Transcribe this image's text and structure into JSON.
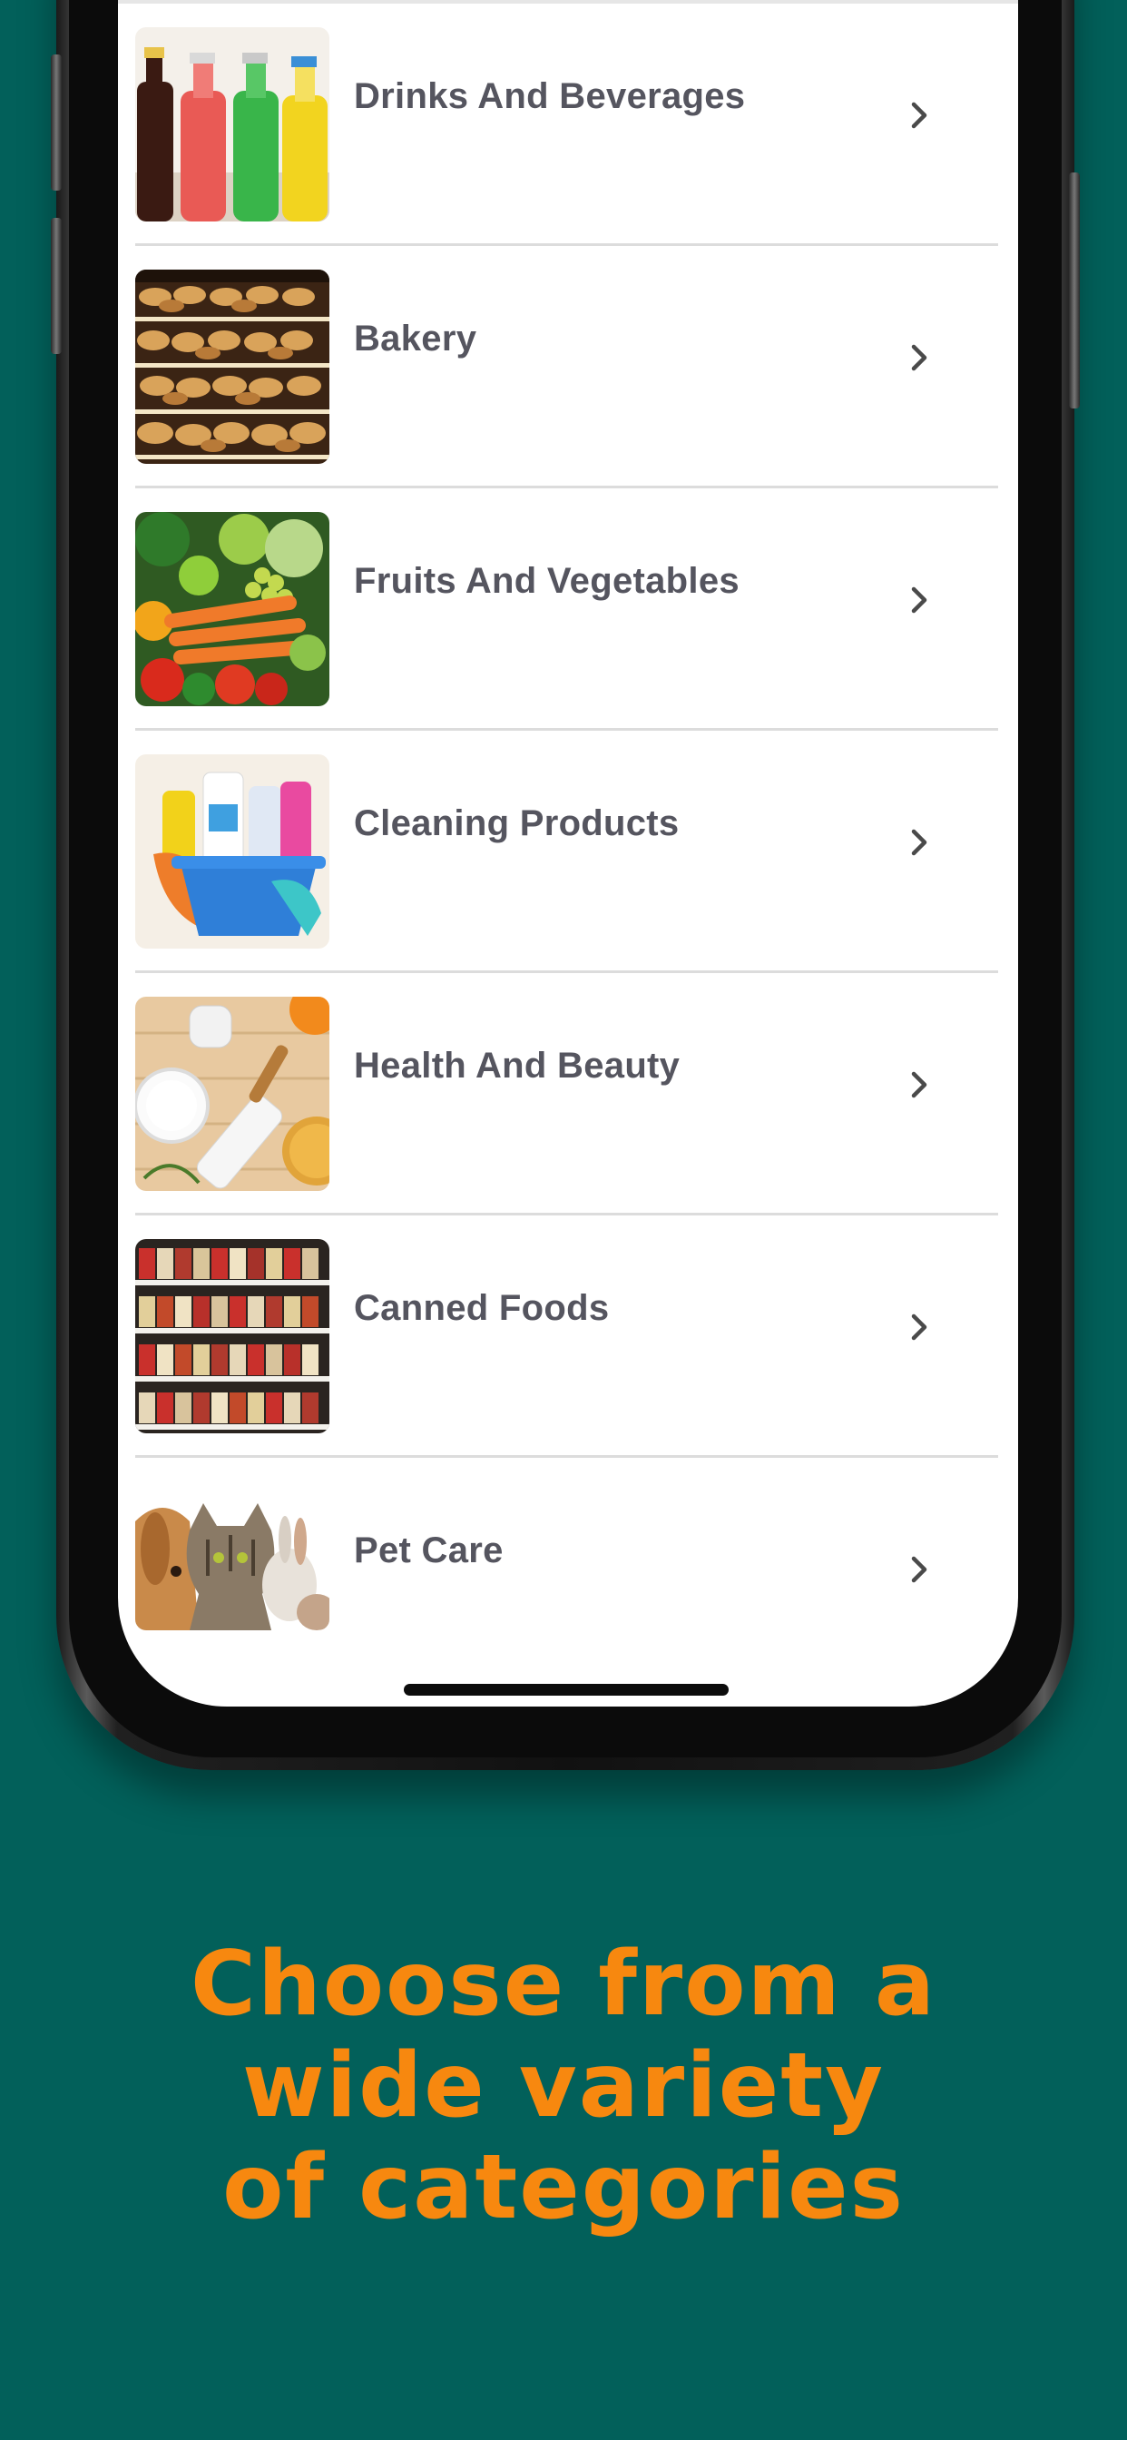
{
  "screen": {
    "categories": [
      {
        "label": "Drinks And Beverages",
        "image": "bottles-image"
      },
      {
        "label": "Bakery",
        "image": "bread-shelves-image"
      },
      {
        "label": "Fruits And Vegetables",
        "image": "produce-image"
      },
      {
        "label": "Cleaning Products",
        "image": "cleaning-supplies-image"
      },
      {
        "label": "Health And Beauty",
        "image": "cosmetics-image"
      },
      {
        "label": "Canned Foods",
        "image": "canned-shelves-image"
      },
      {
        "label": "Pet Care",
        "image": "pets-image"
      }
    ],
    "chevron_icon": "chevron-right-icon"
  },
  "promo": {
    "tagline_lines": [
      "Choose from a",
      "wide variety",
      "of categories"
    ]
  },
  "colors": {
    "background": "#02605a",
    "tagline": "#f7880f",
    "label_text": "#55555f"
  }
}
